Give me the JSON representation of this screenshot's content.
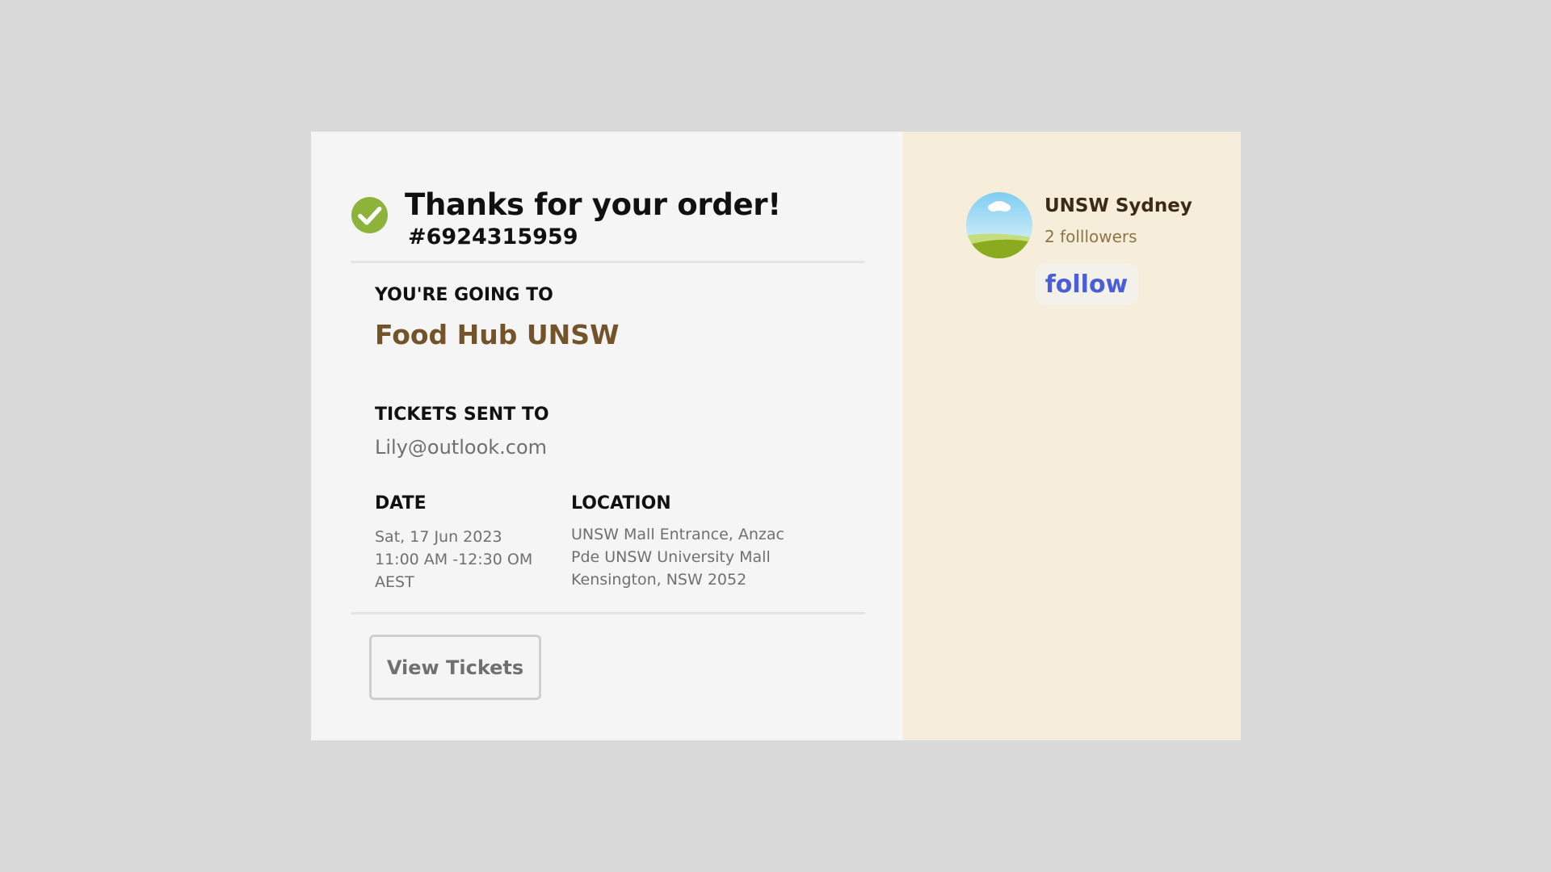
{
  "confirmation": {
    "title": "Thanks for your order!",
    "order_number": "#6924315959"
  },
  "event": {
    "heading": "YOU'RE GOING TO",
    "name": "Food Hub UNSW"
  },
  "tickets": {
    "heading": "TICKETS SENT TO",
    "email": "Lily@outlook.com"
  },
  "date": {
    "heading": "DATE",
    "lines": [
      "Sat, 17 Jun 2023",
      "11:00 AM -12:30 OM",
      "AEST"
    ]
  },
  "location": {
    "heading": "LOCATION",
    "lines": [
      "UNSW Mall Entrance, Anzac",
      "Pde UNSW University Mall",
      "Kensington, NSW 2052"
    ]
  },
  "actions": {
    "view_tickets_label": "View Tickets"
  },
  "organizer": {
    "name": "UNSW Sydney",
    "followers": "2 folllowers",
    "follow_label": "follow"
  },
  "colors": {
    "page_background": "#d9d9d9",
    "main_panel": "#f5f5f5",
    "side_panel": "#f6eeda",
    "check_green": "#8db33b",
    "event_brown": "#73542a",
    "follow_blue": "#4a5ed6"
  },
  "icons": {
    "check": "check-circle-icon",
    "avatar": "landscape-avatar-icon"
  }
}
